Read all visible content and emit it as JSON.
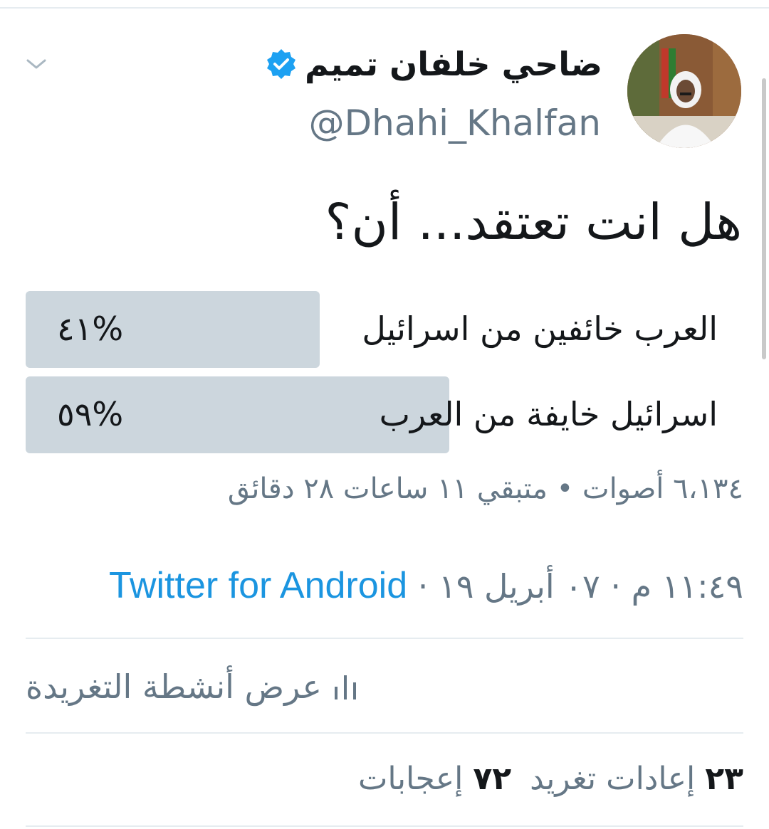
{
  "header": {
    "display_name": "ضاحي خلفان تميم",
    "handle": "@Dhahi_Khalfan",
    "verified": true
  },
  "tweet": {
    "text": "هل انت تعتقد... أن؟"
  },
  "poll": {
    "options": [
      {
        "label": "العرب خائفين من اسرائيل",
        "percent_text": "%٤١",
        "percent": 41
      },
      {
        "label": "اسرائيل خايفة من العرب",
        "percent_text": "%٥٩",
        "percent": 59
      }
    ],
    "meta": "٦،١٣٤ أصوات • متبقي ١١ ساعات ٢٨ دقائق"
  },
  "timestamp": {
    "time_date": "١١:٤٩ م · ٠٧ أبريل ١٩ ·",
    "source": "Twitter for Android"
  },
  "activity": {
    "label": "عرض أنشطة التغريدة"
  },
  "stats": {
    "retweets_count": "٢٣",
    "retweets_label": "إعادات تغريد",
    "likes_count": "٧٢",
    "likes_label": "إعجابات"
  },
  "colors": {
    "accent": "#1b95e0",
    "poll_fill": "#ccd6dd",
    "secondary_text": "#657786",
    "divider": "#e6ecf0"
  }
}
